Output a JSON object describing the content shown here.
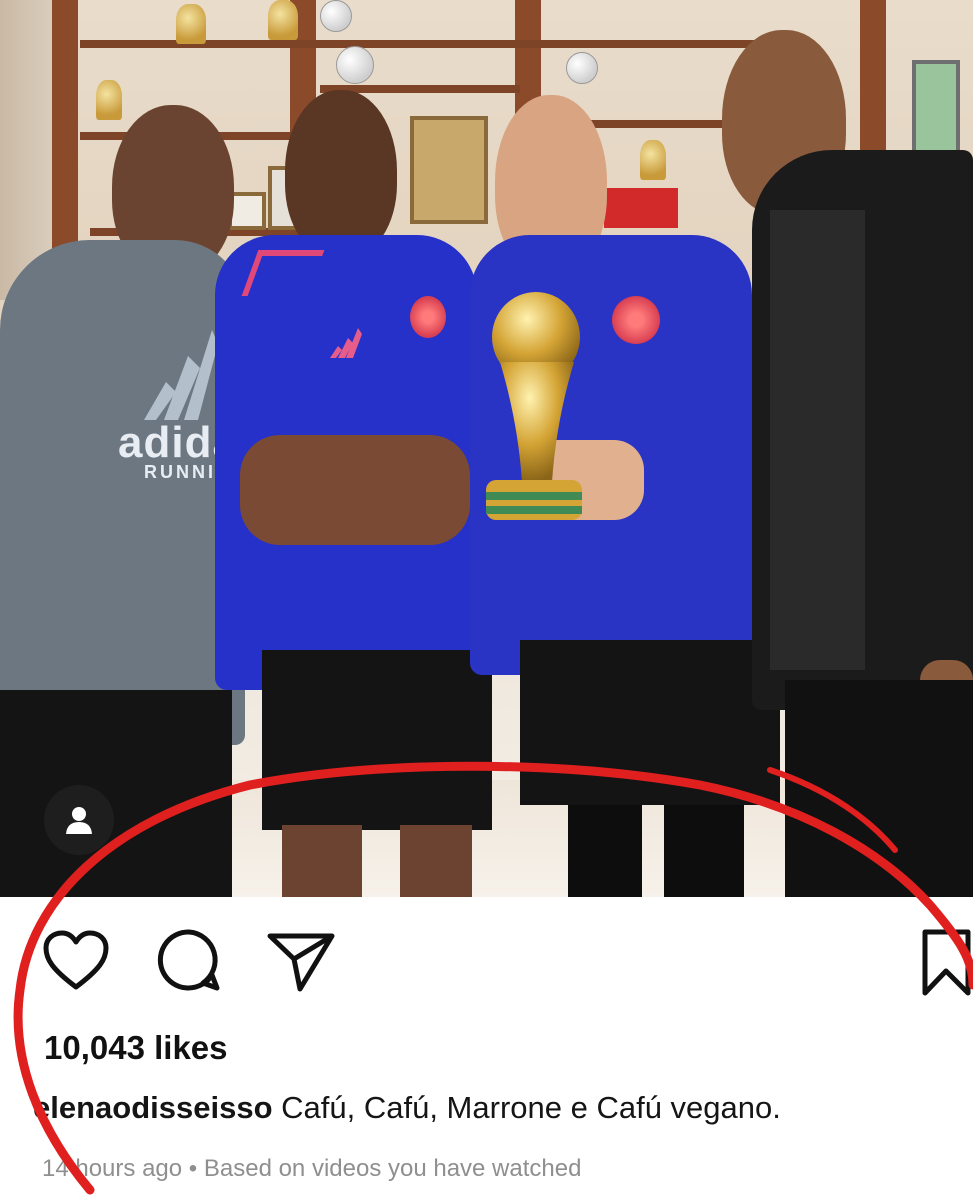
{
  "post": {
    "likes_count": "10,043",
    "likes_word": "likes",
    "username": "elenaodisseisso",
    "caption": "Cafú, Cafú, Marrone e Cafú vegano.",
    "time_ago": "14 hours ago",
    "separator": "•",
    "suggestion_reason": "Based on videos you have watched"
  },
  "photo": {
    "shirt_brand_text": "adidas",
    "shirt_sub_text": "RUNNING"
  },
  "icons": {
    "like": "heart-icon",
    "comment": "comment-bubble-icon",
    "share": "paper-plane-icon",
    "save": "bookmark-icon",
    "tagged_people": "person-icon"
  },
  "colors": {
    "annotation_circle": "#e01f1f",
    "text_primary": "#111111",
    "text_secondary": "#8f8f8f",
    "jersey_blue": "#2631c9"
  }
}
